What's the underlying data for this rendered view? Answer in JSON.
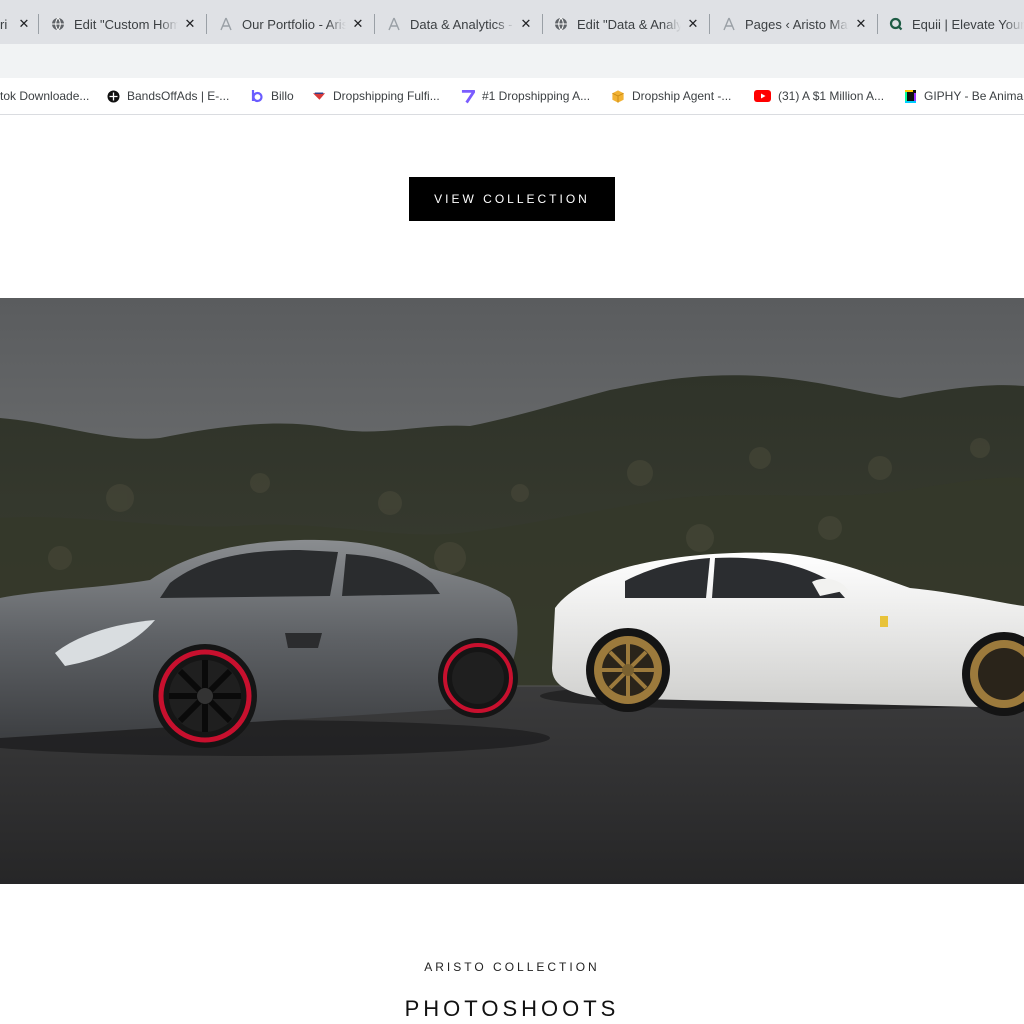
{
  "tabs": [
    {
      "title": "ri",
      "icon": "wordpress-icon",
      "close": "✕"
    },
    {
      "title": "Edit \"Custom Home",
      "icon": "globe-icon",
      "close": "✕"
    },
    {
      "title": "Our Portfolio - Aris",
      "icon": "aristo-logo-icon",
      "close": "✕"
    },
    {
      "title": "Data & Analytics - A",
      "icon": "aristo-logo-icon",
      "close": "✕"
    },
    {
      "title": "Edit \"Data & Analyt",
      "icon": "globe-icon",
      "close": "✕"
    },
    {
      "title": "Pages ‹ Aristo Mark",
      "icon": "aristo-logo-icon",
      "close": "✕"
    },
    {
      "title": "Equii | Elevate Your",
      "icon": "equii-icon",
      "close": ""
    }
  ],
  "bookmarks": [
    {
      "label": "tok Downloade...",
      "icon": ""
    },
    {
      "label": "BandsOffAds | E-...",
      "icon": "bandsoffads-icon"
    },
    {
      "label": "Billo",
      "icon": "billo-icon"
    },
    {
      "label": "Dropshipping Fulfi...",
      "icon": "dropshipping-fulfillment-icon"
    },
    {
      "label": "#1 Dropshipping A...",
      "icon": "dropshipping-app-icon"
    },
    {
      "label": "Dropship Agent -...",
      "icon": "dropship-agent-icon"
    },
    {
      "label": "(31) A $1 Million A...",
      "icon": "youtube-icon"
    },
    {
      "label": "GIPHY - Be Anima",
      "icon": "giphy-icon"
    }
  ],
  "page": {
    "cta_label": "VIEW COLLECTION",
    "eyebrow": "ARISTO COLLECTION",
    "section_title": "PHOTOSHOOTS"
  },
  "colors": {
    "tab_strip": "#dfe1e5",
    "cta_background": "#000000",
    "grey_car": "#5e6165",
    "white_car": "#f2f2f0",
    "brake_caliper": "#c8102e",
    "bronze_wheel": "#9c7a3c"
  }
}
